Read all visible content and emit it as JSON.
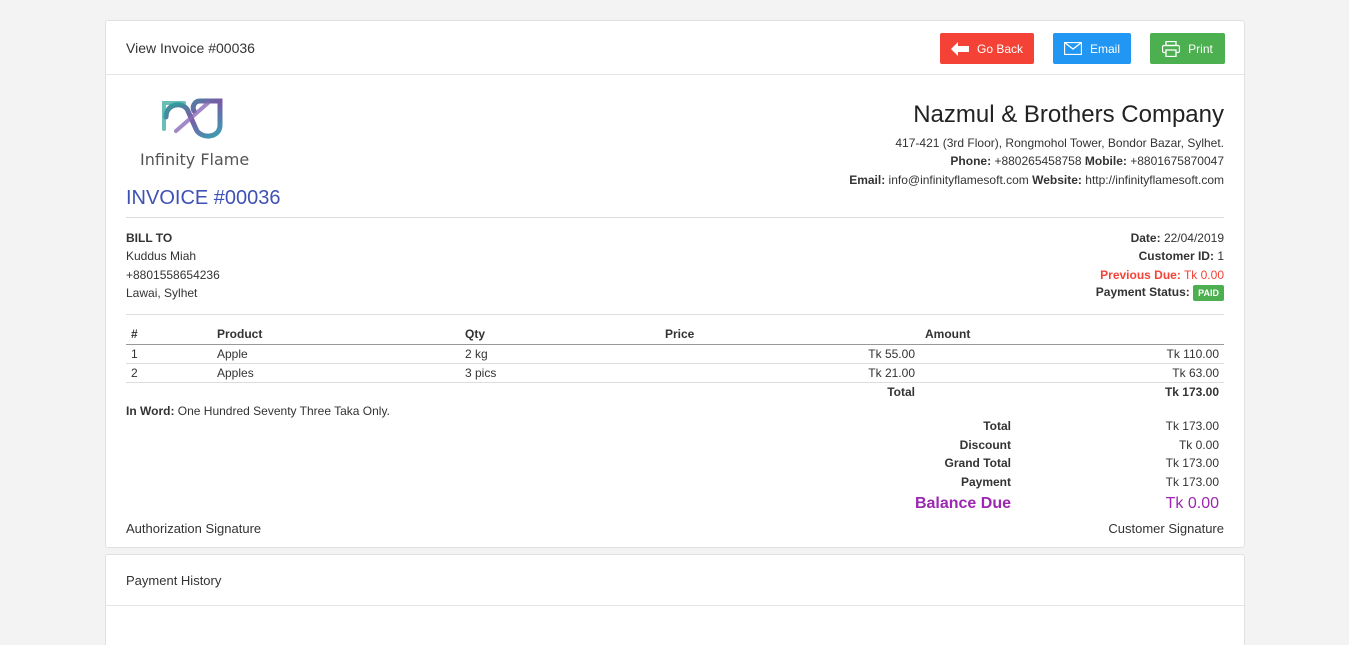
{
  "header": {
    "title": "View Invoice #00036",
    "go_back_label": "Go Back",
    "email_label": "Email",
    "print_label": "Print"
  },
  "logo": {
    "text": "Infinity Flame"
  },
  "company": {
    "name": "Nazmul & Brothers Company",
    "address": "417-421 (3rd Floor), Rongmohol Tower, Bondor Bazar, Sylhet.",
    "phone_label": "Phone:",
    "phone": "+880265458758",
    "mobile_label": "Mobile:",
    "mobile": "+8801675870047",
    "email_label": "Email:",
    "email": "info@infinityflamesoft.com",
    "website_label": "Website:",
    "website": "http://infinityflamesoft.com"
  },
  "invoice": {
    "number": "INVOICE #00036"
  },
  "bill_to": {
    "heading": "BILL TO",
    "name": "Kuddus Miah",
    "phone": "+8801558654236",
    "address": "Lawai, Sylhet"
  },
  "meta": {
    "date_label": "Date:",
    "date": "22/04/2019",
    "customer_id_label": "Customer ID:",
    "customer_id": "1",
    "previous_due_label": "Previous Due:",
    "previous_due": "Tk 0.00",
    "payment_status_label": "Payment Status:",
    "payment_status": "PAID"
  },
  "items": {
    "columns": [
      "#",
      "Product",
      "Qty",
      "Price",
      "Amount"
    ],
    "rows": [
      [
        "1",
        "Apple",
        "2 kg",
        "Tk 55.00",
        "Tk 110.00"
      ],
      [
        "2",
        "Apples",
        "3 pics",
        "Tk 21.00",
        "Tk 63.00"
      ]
    ],
    "total_label": "Total",
    "total": "Tk 173.00"
  },
  "in_word": {
    "label": "In Word:",
    "text": "One Hundred Seventy Three Taka Only."
  },
  "summary": {
    "total_label": "Total",
    "total": "Tk 173.00",
    "discount_label": "Discount",
    "discount": "Tk 0.00",
    "grand_total_label": "Grand Total",
    "grand_total": "Tk 173.00",
    "payment_label": "Payment",
    "payment": "Tk 173.00",
    "balance_due_label": "Balance Due",
    "balance_due": "Tk 0.00"
  },
  "signatures": {
    "authorization": "Authorization Signature",
    "customer": "Customer Signature"
  },
  "payment_history": {
    "title": "Payment History"
  },
  "colors": {
    "go_back": "#f44336",
    "email": "#2196f3",
    "print": "#4caf50",
    "invoice_accent": "#3f51b5",
    "balance_due": "#9c27b0",
    "previous_due": "#f44336",
    "paid_badge": "#4caf50"
  }
}
